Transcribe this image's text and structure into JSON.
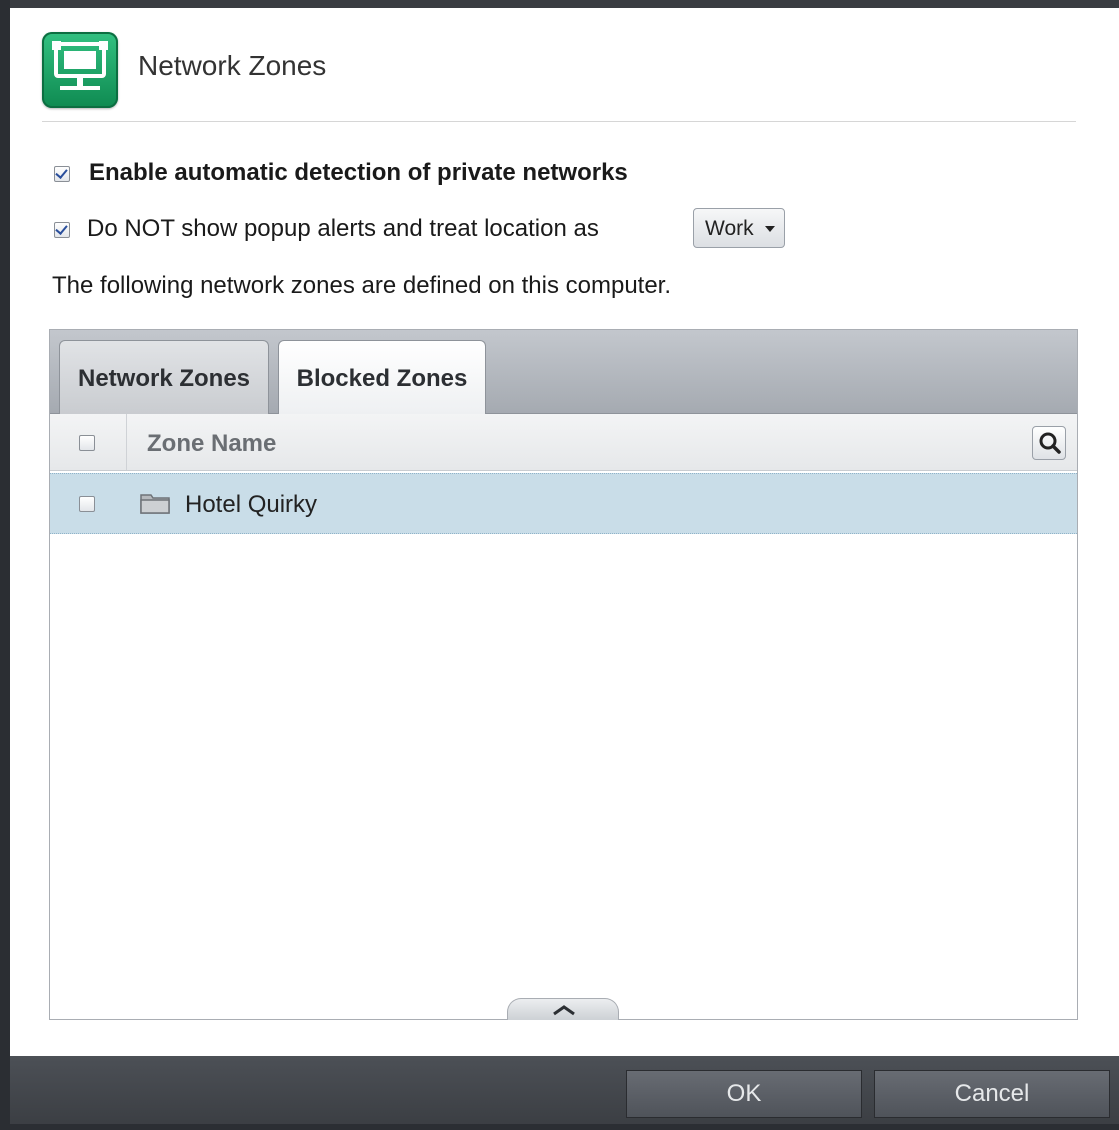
{
  "dialog": {
    "title": "Network Zones",
    "icon": "network-zones-icon"
  },
  "options": {
    "auto_detect": {
      "label": "Enable automatic detection of private networks",
      "checked": true
    },
    "no_popup": {
      "label": "Do NOT show popup alerts and treat location as",
      "checked": true
    },
    "location_select": {
      "value": "Work"
    }
  },
  "description": "The following network zones are defined on this computer.",
  "tabs": [
    {
      "label": "Network Zones",
      "active": false
    },
    {
      "label": "Blocked Zones",
      "active": true
    }
  ],
  "table": {
    "columns": [
      "Zone Name"
    ],
    "rows": [
      {
        "name": "Hotel Quirky",
        "checked": false,
        "selected": true
      }
    ]
  },
  "footer": {
    "ok_label": "OK",
    "cancel_label": "Cancel"
  },
  "colors": {
    "icon_green": "#1fa866",
    "selected_row": "#c9dde8",
    "footer_bg": "#3a3d42"
  }
}
